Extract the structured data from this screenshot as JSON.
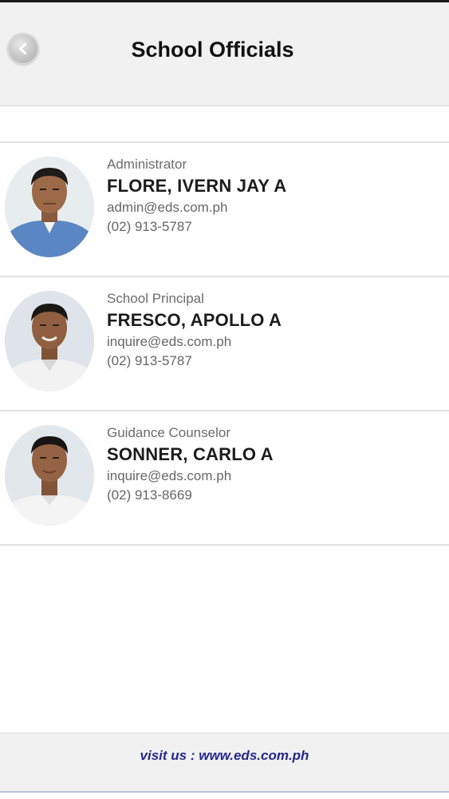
{
  "header": {
    "title": "School Officials",
    "back_icon": "chevron-left-icon"
  },
  "officials": [
    {
      "role": "Administrator",
      "name": "FLORE, IVERN JAY A",
      "email": "admin@eds.com.ph",
      "phone": "(02) 913-5787",
      "shirt_color": "#5b86c4"
    },
    {
      "role": "School Principal",
      "name": "FRESCO, APOLLO A",
      "email": "inquire@eds.com.ph",
      "phone": "(02) 913-5787",
      "shirt_color": "#f2f2f2"
    },
    {
      "role": "Guidance Counselor",
      "name": "SONNER, CARLO A",
      "email": "inquire@eds.com.ph",
      "phone": "(02) 913-8669",
      "shirt_color": "#f4f4f4"
    }
  ],
  "footer": {
    "link_text": "visit us : www.eds.com.ph"
  },
  "colors": {
    "header_bg": "#f1f1f2",
    "footer_link": "#25288c"
  }
}
